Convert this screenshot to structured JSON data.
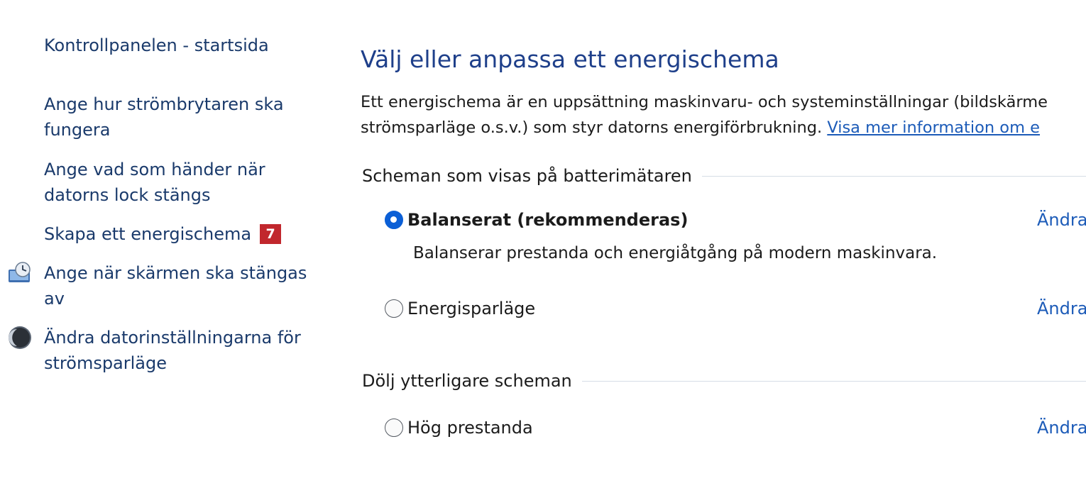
{
  "sidebar": {
    "home_link": "Kontrollpanelen - startsida",
    "items": [
      {
        "label": "Ange hur strömbrytaren ska\nfungera"
      },
      {
        "label": "Ange vad som händer när\ndatorns lock stängs"
      },
      {
        "label": "Skapa ett energischema",
        "badge": "7"
      },
      {
        "label": "Ange när skärmen ska stängas\nav",
        "icon": "monitor-clock-icon"
      },
      {
        "label": "Ändra datorinställningarna för\nströmsparläge",
        "icon": "moon-icon"
      }
    ]
  },
  "main": {
    "title": "Välj eller anpassa ett energischema",
    "description_line1": "Ett energischema är en uppsättning maskinvaru- och systeminställningar (bildskärme",
    "description_line2_prefix": "strömsparläge o.s.v.) som styr datorns energiförbrukning. ",
    "description_link": "Visa mer information om e",
    "groups": [
      {
        "header": "Scheman som visas på batterimätaren",
        "plans": [
          {
            "name": "Balanserat (rekommenderas)",
            "selected": true,
            "description": "Balanserar prestanda och energiåtgång på modern maskinvara.",
            "change_label": "Ändra"
          },
          {
            "name": "Energisparläge",
            "selected": false,
            "change_label": "Ändra"
          }
        ]
      },
      {
        "header": "Dölj ytterligare scheman",
        "plans": [
          {
            "name": "Hög prestanda",
            "selected": false,
            "change_label": "Ändra"
          }
        ]
      }
    ]
  },
  "colors": {
    "title": "#1e3f8a",
    "link": "#1c5bb8",
    "sidebar_text": "#1a3a6b",
    "badge": "#c1272d",
    "radio_selected": "#0b5fd6"
  }
}
